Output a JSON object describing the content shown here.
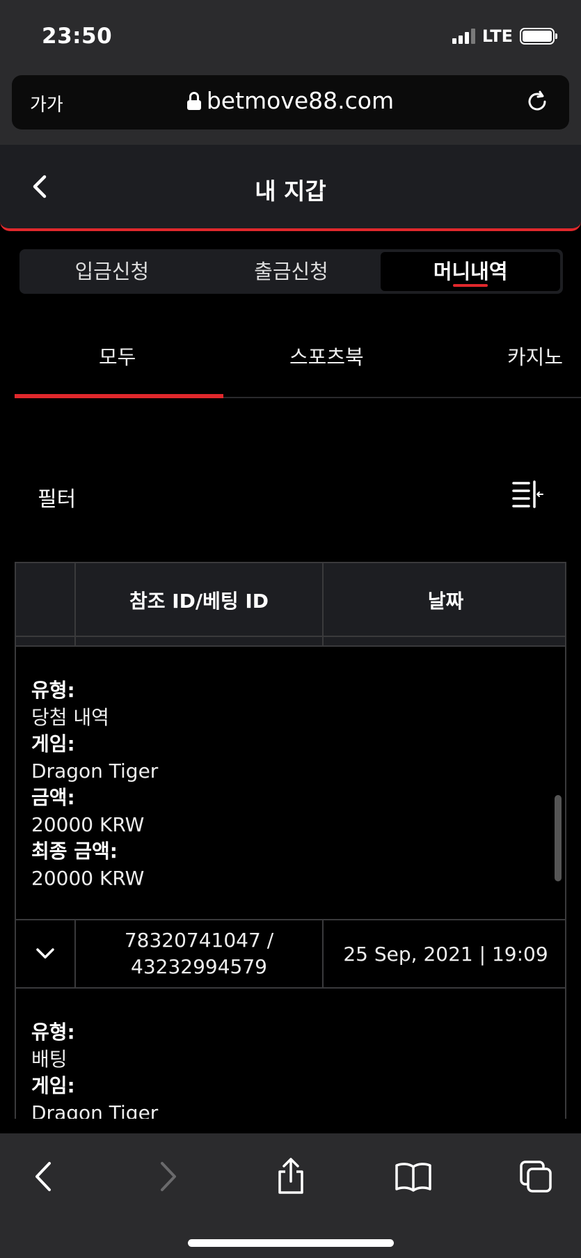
{
  "status_bar": {
    "time": "23:50",
    "network": "LTE"
  },
  "browser": {
    "text_size_label": "가가",
    "url": "betmove88.com"
  },
  "header": {
    "title": "내 지갑"
  },
  "segments": [
    {
      "label": "입금신청"
    },
    {
      "label": "출금신청"
    },
    {
      "label": "머니내역",
      "active": true
    }
  ],
  "subtabs": [
    {
      "label": "모두",
      "active": true
    },
    {
      "label": "스포츠북"
    },
    {
      "label": "카지노"
    }
  ],
  "filter": {
    "label": "필터"
  },
  "table": {
    "columns": [
      "참조 ID/베팅 ID",
      "날짜"
    ],
    "expanded_detail_1": {
      "type_label": "유형:",
      "type_value": "당첨 내역",
      "game_label": "게임:",
      "game_value": "Dragon Tiger",
      "amount_label": "금액:",
      "amount_value": "20000 KRW",
      "final_label": "최종 금액:",
      "final_value": "20000 KRW"
    },
    "row": {
      "ref_id": "78320741047 /",
      "bet_id": "43232994579",
      "date": "25 Sep, 2021 | 19:09"
    },
    "expanded_detail_2": {
      "type_label": "유형:",
      "type_value": "배팅",
      "game_label": "게임:",
      "game_value": "Dragon Tiger"
    }
  },
  "icons": {
    "lock": "lock-icon",
    "reload": "reload-icon",
    "back": "back-icon",
    "filter": "filter-icon",
    "chevron": "chevron-down-icon",
    "share": "share-icon",
    "bookmarks": "book-icon",
    "tabs": "tabs-icon"
  },
  "colors": {
    "accent": "#e0282c",
    "panel": "#1d1e22",
    "background": "#000000"
  }
}
